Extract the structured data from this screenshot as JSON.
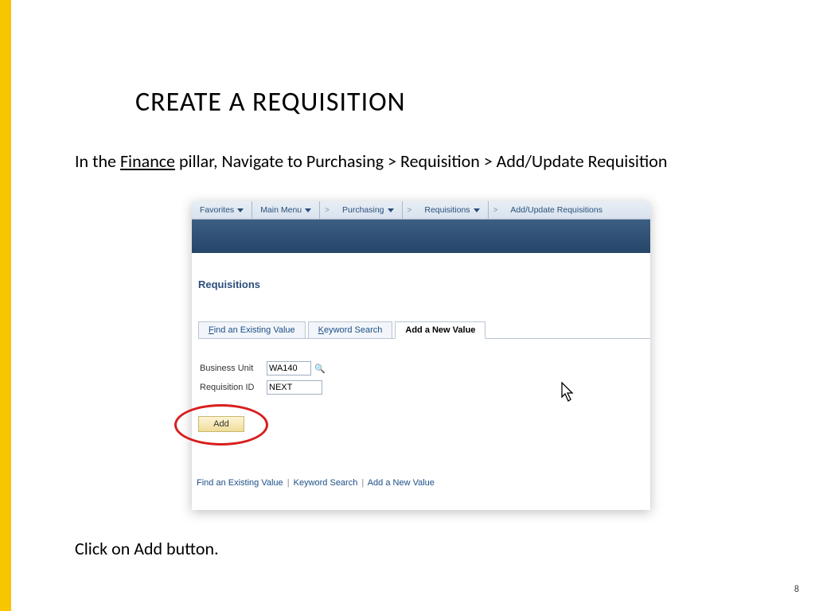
{
  "slide": {
    "title": "CREATE A REQUISITION",
    "instruction_prefix": "In the ",
    "instruction_pillar": "Finance",
    "instruction_suffix": " pillar, Navigate to Purchasing > Requisition > Add/Update Requisition",
    "bottom_instruction": "Click on Add button.",
    "page_number": "8"
  },
  "crumbs": {
    "favorites": "Favorites",
    "main_menu": "Main Menu",
    "purchasing": "Purchasing",
    "requisitions": "Requisitions",
    "add_update": "Add/Update Requisitions",
    "sep": ">"
  },
  "page": {
    "section_title": "Requisitions"
  },
  "tabs": {
    "find_letter": "F",
    "find_rest": "ind an Existing Value",
    "keyword_letter": "K",
    "keyword_rest": "eyword Search",
    "add": "Add a New Value"
  },
  "form": {
    "bu_label": "Business Unit",
    "bu_value": "WA140",
    "req_label": "Requisition ID",
    "req_value": "NEXT",
    "add_button": "Add"
  },
  "links": {
    "find": "Find an Existing Value",
    "keyword": "Keyword Search",
    "add": "Add a New Value",
    "pipe": "|"
  }
}
